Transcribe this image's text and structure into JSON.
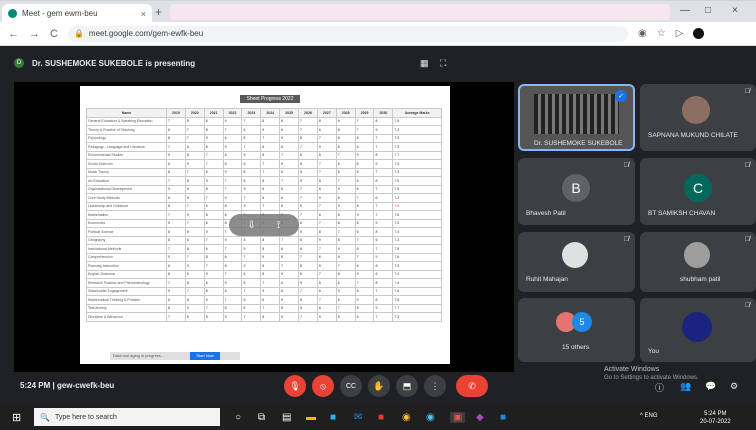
{
  "browser": {
    "tab_title": "Meet - gem ewm-beu",
    "tab_close": "×",
    "new_tab": "+",
    "win_min": "—",
    "win_max": "□",
    "win_close": "×",
    "url": "meet.google.com/gem-ewfk-beu",
    "nav_back": "←",
    "nav_forward": "→",
    "reload": "C",
    "lock": "🔒"
  },
  "meet": {
    "presenting_banner": "Dr. SUSHEMOKE SUKEBOLE is presenting",
    "banner_initial": "D",
    "meeting_time": "5:24 PM",
    "separator": "|",
    "meeting_code": "gew-cwefk-beu",
    "overlay": {
      "pin": "⇩",
      "hide": "⟟"
    },
    "activate_windows": "Activate Windows",
    "activate_sub": "Go to Settings to activate Windows."
  },
  "sheet": {
    "title": "Sheet Progress 2022",
    "headers": [
      "Name",
      "2019",
      "2020",
      "2021",
      "2022",
      "2023",
      "2024",
      "2025",
      "2026",
      "2027",
      "2028",
      "2029",
      "2030",
      "Average Marks"
    ],
    "rows": [
      [
        "General Education & Speaking Education",
        "7",
        "8",
        "6",
        "9",
        "7",
        "8",
        "6",
        "7",
        "8",
        "9",
        "7",
        "8",
        "7.5"
      ],
      [
        "Theory & Practice of Teaching",
        "6",
        "7",
        "8",
        "7",
        "6",
        "9",
        "8",
        "7",
        "6",
        "8",
        "7",
        "9",
        "7.3"
      ],
      [
        "Psychology",
        "8",
        "7",
        "9",
        "6",
        "8",
        "7",
        "9",
        "8",
        "7",
        "6",
        "8",
        "7",
        "7.5"
      ],
      [
        "Pedagogy - Language and Literature",
        "7",
        "6",
        "8",
        "9",
        "7",
        "6",
        "8",
        "7",
        "9",
        "8",
        "6",
        "7",
        "7.3"
      ],
      [
        "Environmental Studies",
        "9",
        "8",
        "7",
        "6",
        "9",
        "8",
        "7",
        "6",
        "8",
        "7",
        "9",
        "8",
        "7.7"
      ],
      [
        "Social Sciences",
        "6",
        "9",
        "7",
        "8",
        "6",
        "7",
        "9",
        "8",
        "7",
        "6",
        "8",
        "9",
        "7.5"
      ],
      [
        "Music Theory",
        "8",
        "7",
        "6",
        "9",
        "8",
        "7",
        "6",
        "9",
        "7",
        "8",
        "6",
        "7",
        "7.3"
      ],
      [
        "Art Education",
        "7",
        "8",
        "9",
        "7",
        "6",
        "8",
        "7",
        "9",
        "8",
        "7",
        "6",
        "8",
        "7.5"
      ],
      [
        "Organizational Development",
        "9",
        "6",
        "8",
        "7",
        "9",
        "6",
        "8",
        "7",
        "6",
        "9",
        "8",
        "7",
        "7.5"
      ],
      [
        "Core Study Methods",
        "6",
        "8",
        "7",
        "9",
        "7",
        "8",
        "6",
        "7",
        "9",
        "8",
        "7",
        "6",
        "7.3"
      ],
      [
        "Leadership and Guidance",
        "8",
        "7",
        "6",
        "8",
        "9",
        "7",
        "8",
        "6",
        "7",
        "9",
        "8",
        "7",
        "7.5"
      ],
      [
        "Mathematics",
        "7",
        "9",
        "8",
        "6",
        "7",
        "8",
        "9",
        "7",
        "6",
        "8",
        "9",
        "7",
        "7.6"
      ],
      [
        "Economics",
        "9",
        "7",
        "6",
        "8",
        "7",
        "9",
        "6",
        "8",
        "7",
        "6",
        "8",
        "9",
        "7.5"
      ],
      [
        "Political Science",
        "6",
        "8",
        "9",
        "7",
        "8",
        "6",
        "7",
        "9",
        "8",
        "7",
        "6",
        "8",
        "7.4"
      ],
      [
        "Geography",
        "8",
        "6",
        "7",
        "9",
        "6",
        "8",
        "7",
        "6",
        "9",
        "8",
        "7",
        "6",
        "7.3"
      ],
      [
        "Instructional Methods",
        "7",
        "8",
        "6",
        "7",
        "9",
        "8",
        "6",
        "8",
        "7",
        "9",
        "8",
        "7",
        "7.5"
      ],
      [
        "Comprehension",
        "9",
        "7",
        "8",
        "6",
        "7",
        "9",
        "8",
        "7",
        "6",
        "8",
        "7",
        "9",
        "7.6"
      ],
      [
        "Planning Instruction",
        "6",
        "9",
        "7",
        "8",
        "9",
        "6",
        "7",
        "8",
        "9",
        "7",
        "6",
        "8",
        "7.5"
      ],
      [
        "English Grammar",
        "8",
        "6",
        "9",
        "7",
        "6",
        "8",
        "9",
        "6",
        "7",
        "8",
        "9",
        "6",
        "7.4"
      ],
      [
        "Research Practice and Phenomenology",
        "7",
        "8",
        "6",
        "9",
        "8",
        "7",
        "6",
        "9",
        "8",
        "6",
        "7",
        "8",
        "7.4"
      ],
      [
        "Stakeholder Engagement",
        "9",
        "7",
        "8",
        "6",
        "7",
        "9",
        "8",
        "7",
        "6",
        "9",
        "8",
        "7",
        "7.6"
      ],
      [
        "Mathematical Thinking & Problem",
        "6",
        "8",
        "9",
        "7",
        "8",
        "6",
        "9",
        "8",
        "7",
        "6",
        "9",
        "8",
        "7.6"
      ],
      [
        "Test Anxiety",
        "8",
        "9",
        "7",
        "8",
        "6",
        "7",
        "8",
        "9",
        "6",
        "7",
        "8",
        "9",
        "7.7"
      ],
      [
        "Discipline & Behaviour",
        "7",
        "6",
        "8",
        "9",
        "7",
        "8",
        "6",
        "7",
        "9",
        "8",
        "6",
        "7",
        "7.3"
      ]
    ],
    "status_tab": "Data tool aging in progress...",
    "status_button": "Start Now"
  },
  "participants": [
    {
      "name": "Dr. SUSHEMOKE SUKEBOLE",
      "pinned": "✓"
    },
    {
      "name": "SAPNANA MUKUND CHILATE",
      "avatar_color": "#8d6e63"
    },
    {
      "name": "Bhavesh Patil",
      "initial": "B",
      "avatar_color": "#5f6368"
    },
    {
      "name": "BT SAMIKSH CHAVAN",
      "initial": "C",
      "avatar_color": "#00695c"
    },
    {
      "name": "Ruhit Mahajan",
      "avatar_color": "#e0e0e0"
    },
    {
      "name": "shubham patil",
      "avatar_color": "#9e9e9e"
    },
    {
      "name": "15 others",
      "avatar_color": "#1e88e5"
    },
    {
      "name": "You",
      "avatar_color": "#1a237e"
    }
  ],
  "mute_glyph": "🎙̸",
  "controls": {
    "mic": "🎙",
    "cam": "⦸",
    "captions": "CC",
    "hand": "✋",
    "present": "⬒",
    "more": "⋮",
    "end": "✆"
  },
  "right_controls": {
    "info": "ⓘ",
    "people": "👥",
    "chat": "💬",
    "activities": "⚙"
  },
  "taskbar": {
    "start": "⊞",
    "search_placeholder": "Type here to search",
    "search_glyph": "🔍",
    "time": "5:24 PM",
    "date": "20-07-2022",
    "tray": "^ ENG"
  },
  "colors": {
    "accent": "#1a73e8",
    "danger": "#ea4335",
    "surface": "#3c4043",
    "background": "#202124"
  }
}
